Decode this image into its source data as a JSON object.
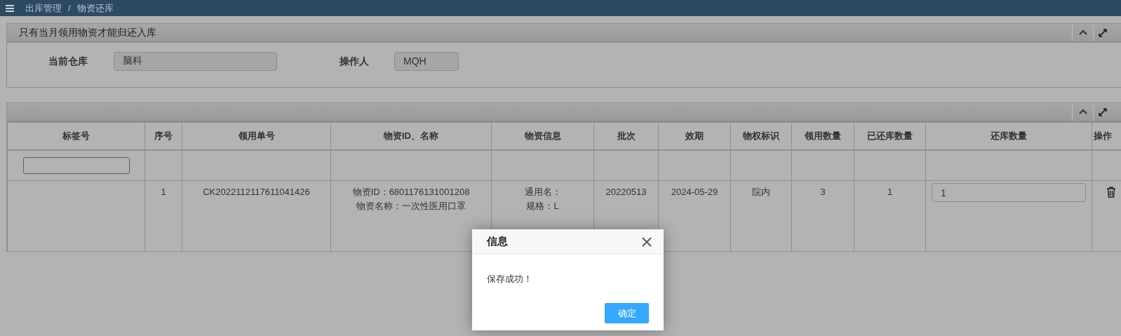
{
  "breadcrumb": {
    "items": [
      "出库管理",
      "物资还库"
    ],
    "separator": "/"
  },
  "info_panel": {
    "title": "只有当月领用物资才能归还入库",
    "fields": [
      {
        "label": "当前仓库",
        "value": "脑科",
        "kind": "wide"
      },
      {
        "label": "操作人",
        "value": "MQH",
        "kind": "narrow"
      }
    ]
  },
  "table": {
    "columns": [
      "标签号",
      "序号",
      "领用单号",
      "物资ID、名称",
      "物资信息",
      "批次",
      "效期",
      "物权标识",
      "领用数量",
      "已还库数量",
      "还库数量",
      "操作"
    ],
    "rows": [
      {
        "cells": [
          {
            "kind": "empty"
          },
          {
            "kind": "text",
            "text": "1"
          },
          {
            "kind": "text",
            "text": "CK2022112117611041426"
          },
          {
            "kind": "lines",
            "lines": [
              "物资ID：6801176131001208",
              "物资名称：一次性医用口罩"
            ]
          },
          {
            "kind": "lines",
            "lines": [
              "通用名：",
              "规格：L"
            ]
          },
          {
            "kind": "text",
            "text": "20220513"
          },
          {
            "kind": "text",
            "text": "2024-05-29"
          },
          {
            "kind": "text",
            "text": "院内"
          },
          {
            "kind": "text",
            "text": "3"
          },
          {
            "kind": "text",
            "text": "1"
          },
          {
            "kind": "input",
            "value": "1"
          },
          {
            "kind": "delete"
          }
        ]
      }
    ]
  },
  "dialog": {
    "title": "信息",
    "message": "保存成功！",
    "button": "确定"
  }
}
